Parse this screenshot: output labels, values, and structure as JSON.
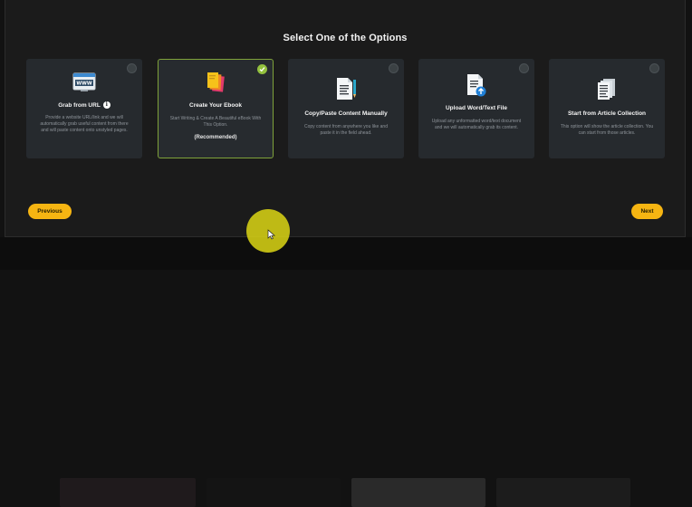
{
  "modal": {
    "title": "Select One of the Options"
  },
  "options": [
    {
      "title": "Grab from URL",
      "icon": "www-browser-icon",
      "description": "Provide a website URL/link and we will automatically grab useful content from there and will paste content onto unstyled pages.",
      "selected": false,
      "has_info": true,
      "info_glyph": "i"
    },
    {
      "title": "Create Your Ebook",
      "icon": "ebook-stack-icon",
      "description": "Start Writing & Create A Beautiful eBook With This Option.",
      "recommended": "(Recommended)",
      "selected": true
    },
    {
      "title": "Copy/Paste Content Manually",
      "icon": "document-pen-icon",
      "description": "Copy content from anywhere you like and paste it in the field ahead.",
      "selected": false
    },
    {
      "title": "Upload Word/Text File",
      "icon": "upload-document-icon",
      "description": "Upload any unformatted word/text document and we will automatically grab its content.",
      "selected": false
    },
    {
      "title": "Start from Article Collection",
      "icon": "article-collection-icon",
      "description": "This option will show the article collection. You can start from those articles.",
      "selected": false
    }
  ],
  "buttons": {
    "previous": "Previous",
    "next": "Next"
  },
  "colors": {
    "accent": "#f6b512",
    "selected_border": "#7fa23a",
    "check": "#93c13e",
    "card_bg": "#262a2e",
    "modal_bg": "#1b1b1b",
    "cursor_highlight": "#d6d014"
  }
}
